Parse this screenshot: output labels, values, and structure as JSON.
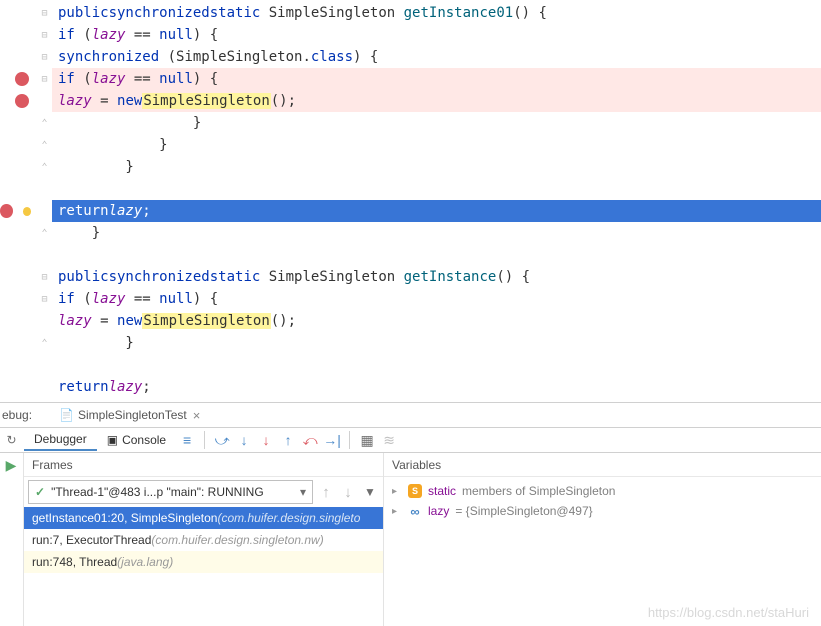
{
  "code": {
    "lines": [
      {
        "html": "    <span class='kw'>public</span> <span class='kw'>synchronized</span> <span class='kw'>static</span> SimpleSingleton <span class='method'>getInstance01</span>() {",
        "bp": false,
        "fold": "-"
      },
      {
        "html": "        <span class='kw'>if</span> (<span class='ident'>lazy</span> == <span class='kw'>null</span>) {",
        "bp": false,
        "fold": "-"
      },
      {
        "html": "            <span class='kw'>synchronized</span> (SimpleSingleton.<span class='kw'>class</span>) {",
        "bp": false,
        "fold": "-"
      },
      {
        "html": "                <span class='kw'>if</span> (<span class='ident'>lazy</span> == <span class='kw'>null</span>) {",
        "bp": true,
        "bphl": true,
        "fold": "-"
      },
      {
        "html": "                    <span class='ident'>lazy</span> = <span class='kw'>new</span> <span class='mark'>SimpleSingleton</span>();",
        "bp": true,
        "bphl": true,
        "fold": ""
      },
      {
        "html": "                }",
        "bp": false,
        "fold": "^"
      },
      {
        "html": "            }",
        "bp": false,
        "fold": "^"
      },
      {
        "html": "        }",
        "bp": false,
        "fold": "^"
      },
      {
        "html": "",
        "bp": false,
        "fold": ""
      },
      {
        "html": "        <span class='kw'>return</span> <span class='ident'>lazy</span>;",
        "bp": true,
        "hl": true,
        "fold": ""
      },
      {
        "html": "    }",
        "bp": false,
        "fold": "^"
      },
      {
        "html": "",
        "bp": false,
        "fold": ""
      },
      {
        "html": "    <span class='kw'>public</span> <span class='kw'>synchronized</span> <span class='kw'>static</span> SimpleSingleton <span class='method'>getInstance</span>() {",
        "bp": false,
        "fold": "-"
      },
      {
        "html": "        <span class='kw'>if</span> (<span class='ident'>lazy</span> == <span class='kw'>null</span>) {",
        "bp": false,
        "fold": "-"
      },
      {
        "html": "            <span class='ident'>lazy</span> = <span class='kw'>new</span> <span class='mark'>SimpleSingleton</span>();",
        "bp": false,
        "fold": ""
      },
      {
        "html": "        }",
        "bp": false,
        "fold": "^"
      },
      {
        "html": "",
        "bp": false,
        "fold": ""
      },
      {
        "html": "        <span class='kw'>return</span> <span class='ident'>lazy</span>;",
        "bp": false,
        "fold": ""
      }
    ]
  },
  "debug": {
    "label": "ebug:",
    "run_config": "SimpleSingletonTest"
  },
  "toolbar": {
    "debugger_tab": "Debugger",
    "console_tab": "Console"
  },
  "frames": {
    "title": "Frames",
    "thread": "\"Thread-1\"@483 i...p \"main\": RUNNING",
    "items": [
      {
        "main": "getInstance01:20, SimpleSingleton ",
        "path": "(com.huifer.design.singleto",
        "sel": true
      },
      {
        "main": "run:7, ExecutorThread ",
        "path": "(com.huifer.design.singleton.nw)",
        "sel": false
      },
      {
        "main": "run:748, Thread ",
        "path": "(java.lang)",
        "sel": false,
        "lib": true
      }
    ]
  },
  "variables": {
    "title": "Variables",
    "rows": [
      {
        "icon": "s",
        "label": "static",
        "rest": " members of SimpleSingleton"
      },
      {
        "icon": "o",
        "label": "lazy",
        "rest": " = {SimpleSingleton@497}"
      }
    ]
  },
  "watermark": "https://blog.csdn.net/staHuri"
}
